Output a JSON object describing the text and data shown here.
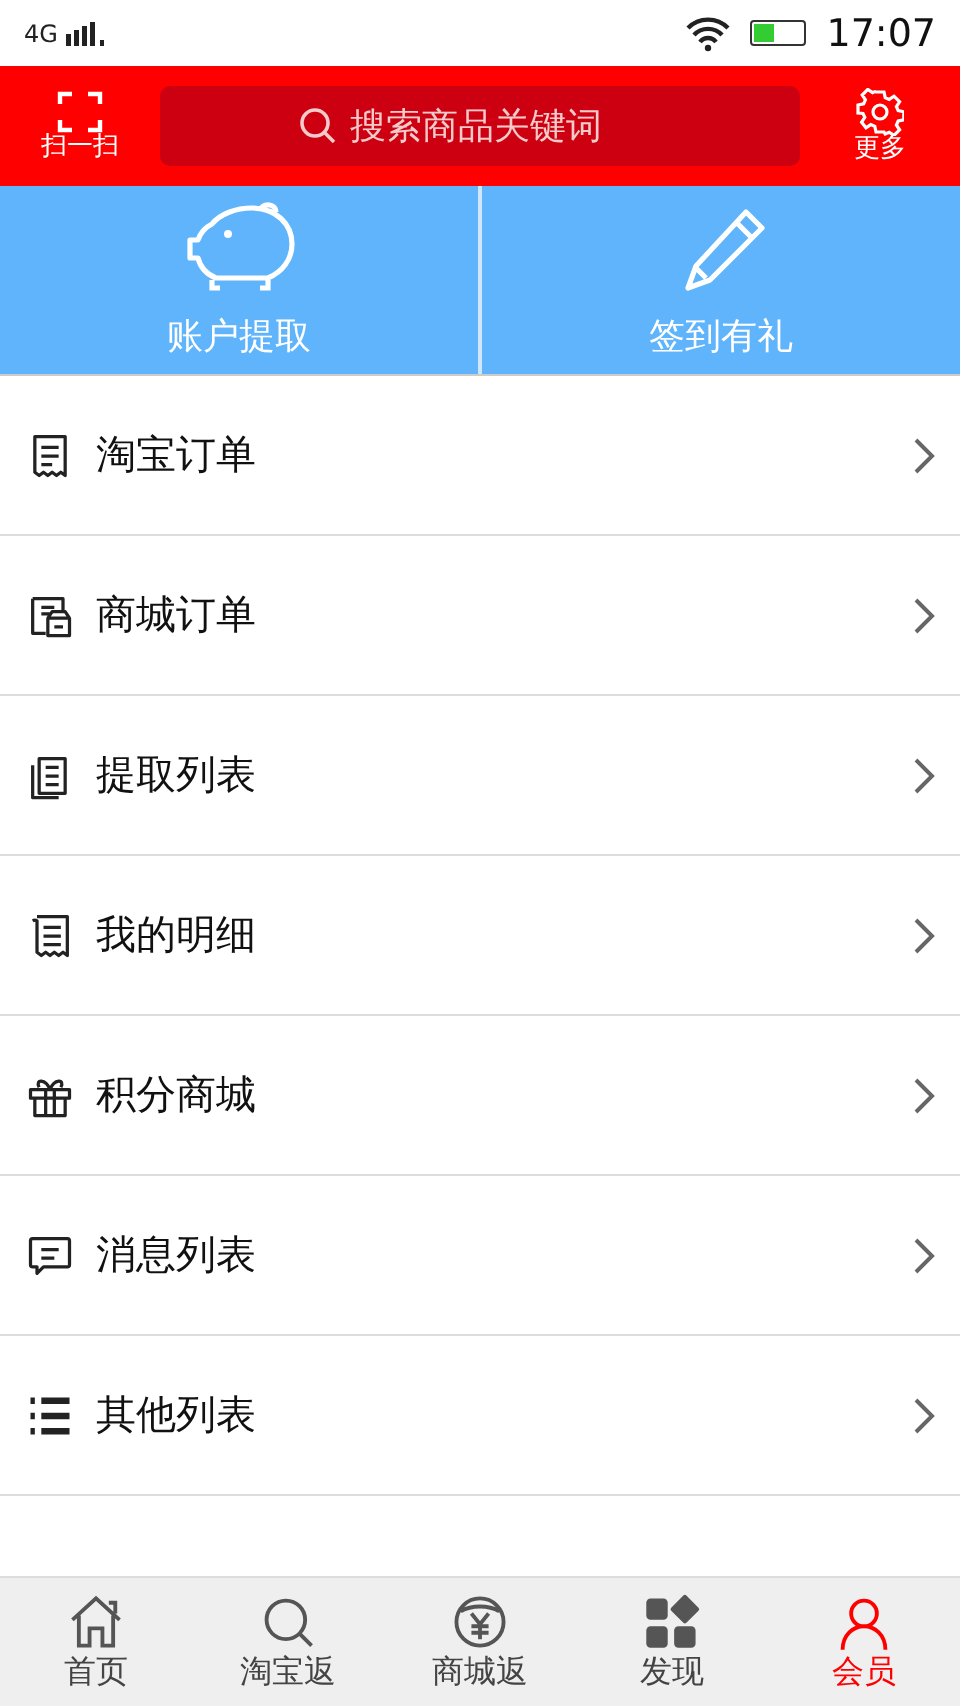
{
  "status_bar": {
    "network": "4G",
    "time": "17:07"
  },
  "header": {
    "scan_label": "扫一扫",
    "search": {
      "placeholder": "搜索商品关键词"
    },
    "more_label": "更多"
  },
  "actions": [
    {
      "label": "账户提取"
    },
    {
      "label": "签到有礼"
    }
  ],
  "menu": [
    {
      "label": "淘宝订单"
    },
    {
      "label": "商城订单"
    },
    {
      "label": "提取列表"
    },
    {
      "label": "我的明细"
    },
    {
      "label": "积分商城"
    },
    {
      "label": "消息列表"
    },
    {
      "label": "其他列表"
    }
  ],
  "tab_bar": [
    {
      "label": "首页",
      "selected": false
    },
    {
      "label": "淘宝返",
      "selected": false
    },
    {
      "label": "商城返",
      "selected": false
    },
    {
      "label": "发现",
      "selected": false
    },
    {
      "label": "会员",
      "selected": true
    }
  ]
}
